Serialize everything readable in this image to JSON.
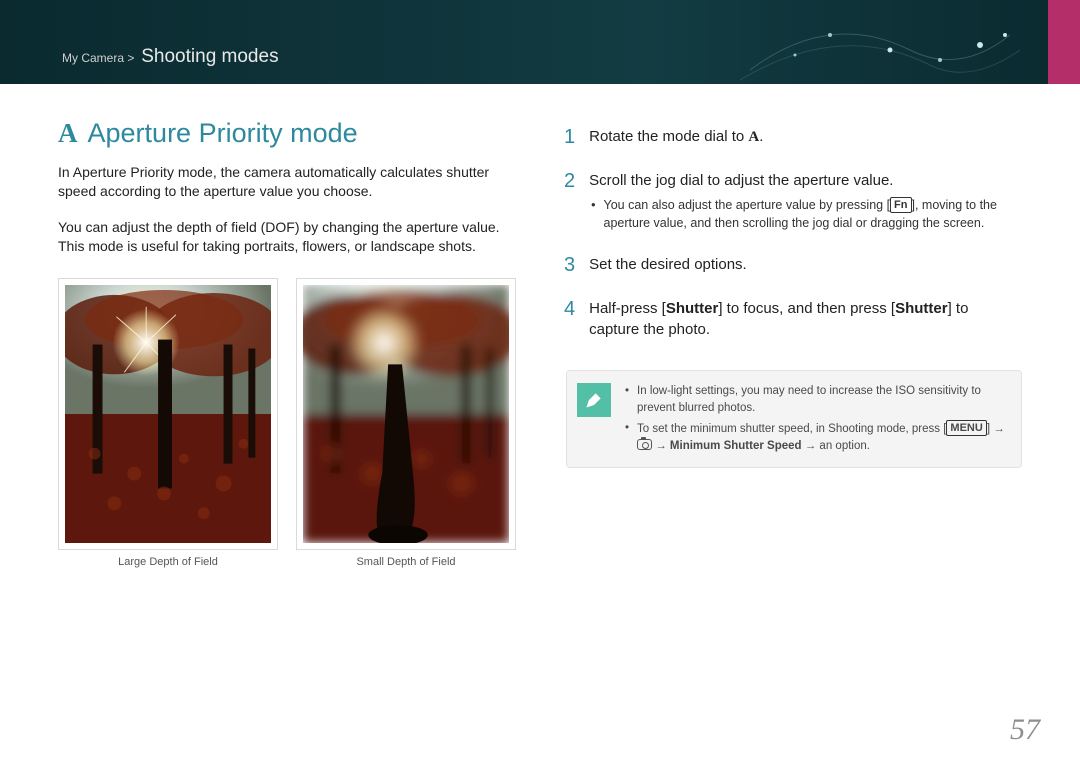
{
  "breadcrumb": {
    "prefix": "My Camera >",
    "current": "Shooting modes"
  },
  "title": {
    "prefix": "A",
    "text": "Aperture Priority mode"
  },
  "para1": "In Aperture Priority mode, the camera automatically calculates shutter speed according to the aperture value you choose.",
  "para2": "You can adjust the depth of field (DOF) by changing the aperture value. This mode is useful for taking portraits, flowers, or landscape shots.",
  "images": {
    "left_caption": "Large Depth of Field",
    "right_caption": "Small Depth of Field"
  },
  "steps": {
    "s1": {
      "num": "1",
      "text_a": "Rotate the mode dial to ",
      "badge": "A",
      "text_b": "."
    },
    "s2": {
      "num": "2",
      "main": "Scroll the jog dial to adjust the aperture value.",
      "sub_a": "You can also adjust the aperture value by pressing [",
      "sub_fn": "Fn",
      "sub_b": "], moving to the aperture value, and then scrolling the jog dial or dragging the screen."
    },
    "s3": {
      "num": "3",
      "main": "Set the desired options."
    },
    "s4": {
      "num": "4",
      "pre": "Half-press [",
      "b1": "Shutter",
      "mid": "] to focus, and then press [",
      "b2": "Shutter",
      "post": "] to capture the photo."
    }
  },
  "note": {
    "n1": "In low-light settings, you may need to increase the ISO sensitivity to prevent blurred photos.",
    "n2_a": "To set the minimum shutter speed, in Shooting mode, press [",
    "n2_menu": "MENU",
    "n2_b": "] → ",
    "n2_c": " → ",
    "n2_bold": "Minimum Shutter Speed",
    "n2_d": " → an option."
  },
  "page_number": "57"
}
